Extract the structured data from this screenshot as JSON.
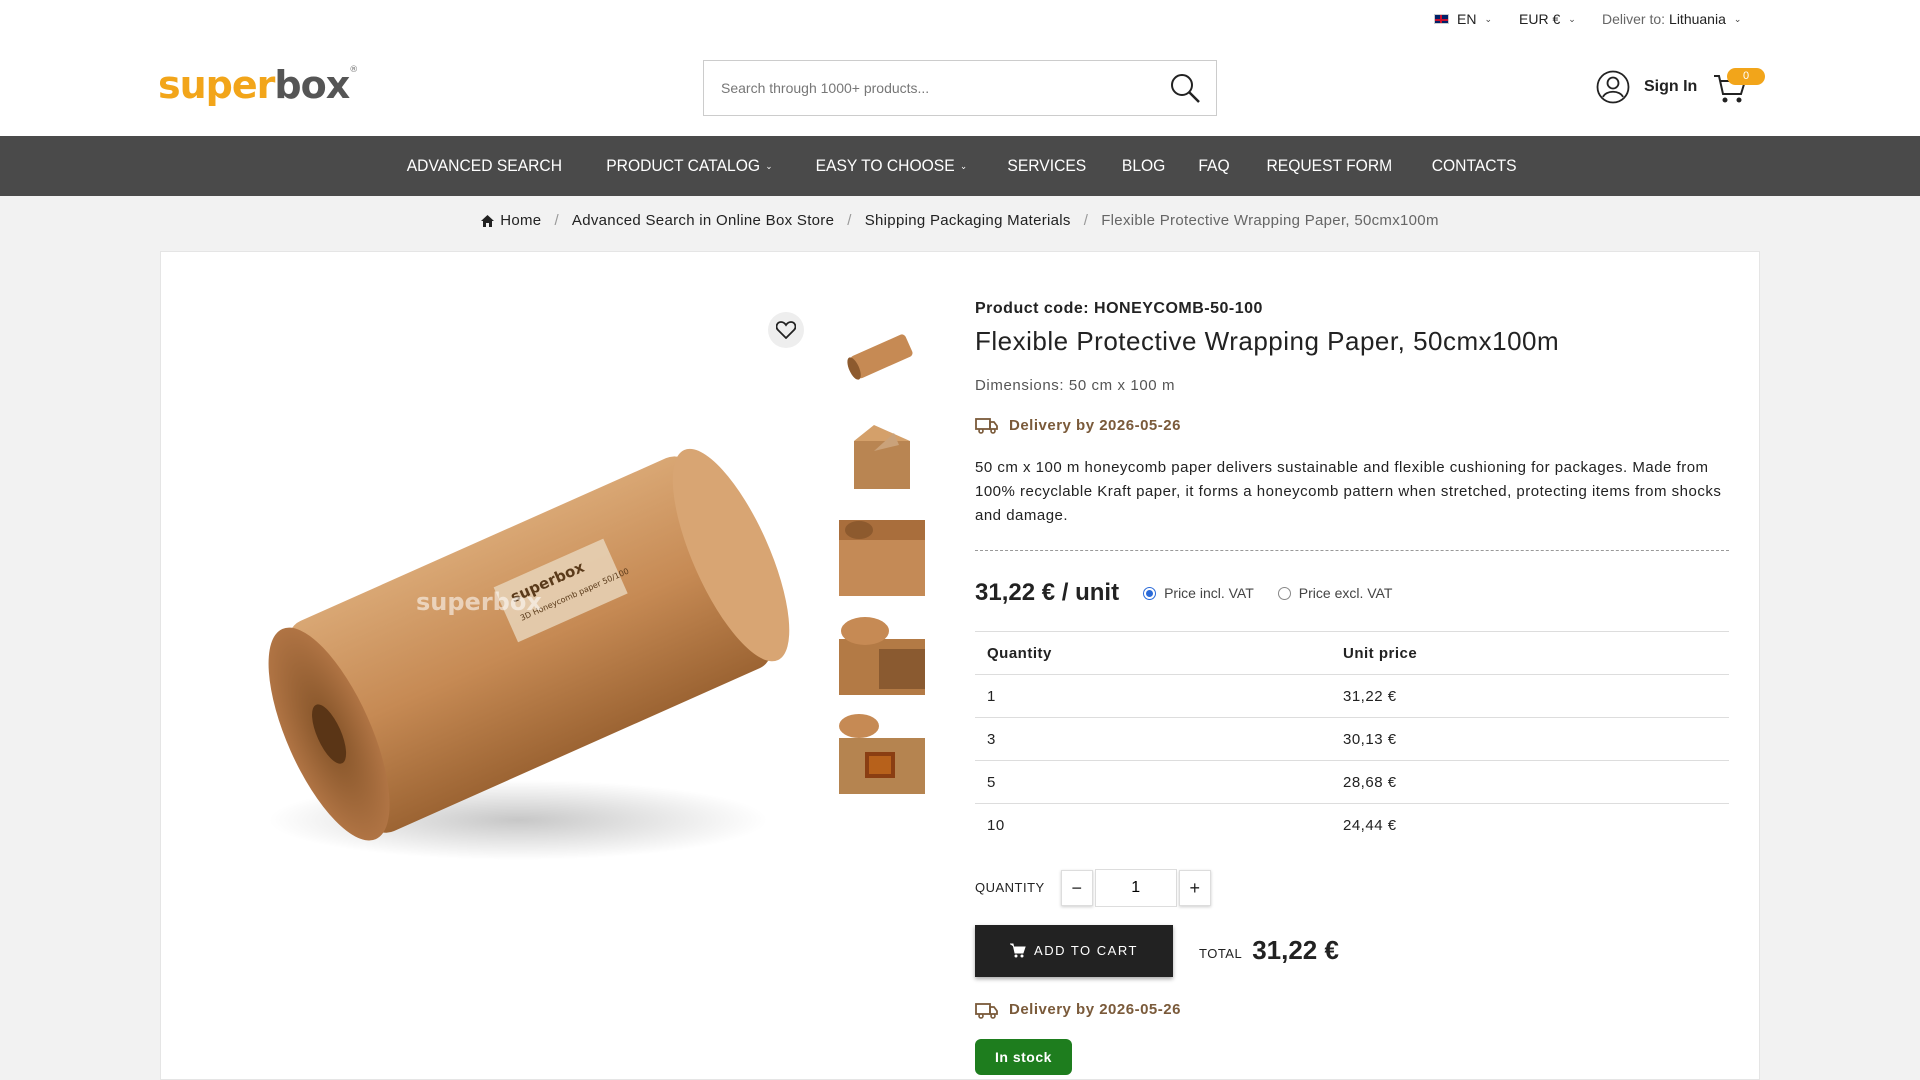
{
  "topbar": {
    "language": "EN",
    "currency": "EUR €",
    "deliver_label": "Deliver to:",
    "deliver_country": "Lithuania"
  },
  "header": {
    "logo_part1": "super",
    "logo_part2": "box",
    "logo_mark": "®",
    "search_placeholder": "Search through 1000+ products...",
    "sign_in": "Sign In",
    "cart_count": "0"
  },
  "nav": {
    "items": [
      {
        "label": "ADVANCED SEARCH",
        "dropdown": false
      },
      {
        "label": "PRODUCT CATALOG",
        "dropdown": true
      },
      {
        "label": "EASY TO CHOOSE",
        "dropdown": true
      },
      {
        "label": "SERVICES",
        "dropdown": false
      },
      {
        "label": "BLOG",
        "dropdown": false
      },
      {
        "label": "FAQ",
        "dropdown": false
      },
      {
        "label": "REQUEST FORM",
        "dropdown": false
      },
      {
        "label": "CONTACTS",
        "dropdown": false
      }
    ]
  },
  "breadcrumb": {
    "home": "Home",
    "level1": "Advanced Search in Online Box Store",
    "level2": "Shipping Packaging Materials",
    "current": "Flexible Protective Wrapping Paper, 50cmx100m"
  },
  "product": {
    "code_label": "Product code:",
    "code": "HONEYCOMB-50-100",
    "title": "Flexible Protective Wrapping Paper, 50cmx100m",
    "dimensions": "Dimensions: 50 cm x 100 m",
    "delivery": "Delivery by 2026-05-26",
    "description": "50 cm x 100 m honeycomb paper delivers sustainable and flexible cushioning for packages. Made from 100% recyclable Kraft paper, it forms a honeycomb pattern when stretched, protecting items from shocks and damage.",
    "price": "31,22 € / unit",
    "vat_options": {
      "incl": "Price incl. VAT",
      "excl": "Price excl. VAT",
      "selected": "incl"
    },
    "tiers": {
      "headers": [
        "Quantity",
        "Unit price"
      ],
      "rows": [
        [
          "1",
          "31,22 €"
        ],
        [
          "3",
          "30,13 €"
        ],
        [
          "5",
          "28,68 €"
        ],
        [
          "10",
          "24,44 €"
        ]
      ]
    },
    "quantity_label": "QUANTITY",
    "quantity_value": "1",
    "add_to_cart": "ADD TO CART",
    "total_label": "TOTAL",
    "total_value": "31,22 €",
    "delivery2": "Delivery by 2026-05-26",
    "stock": "In stock",
    "image_watermark": "superbox",
    "image_label_brand": "superbox",
    "image_label_text": "3D Honeycomb paper 50/100"
  },
  "colors": {
    "brand": "#f2a51a",
    "nav_bg": "#4a4a4a",
    "stock_green": "#1e7d1e",
    "delivery_brown": "#7a5a3a"
  }
}
